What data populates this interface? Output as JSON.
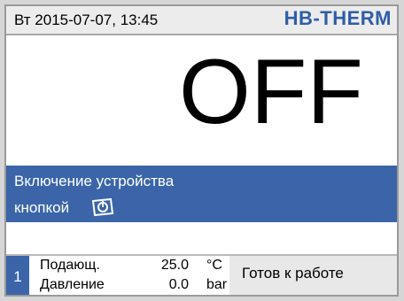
{
  "header": {
    "datetime": "Вт  2015-07-07, 13:45",
    "logo": "HB-THERM"
  },
  "main": {
    "status": "OFF"
  },
  "info": {
    "line1": "Включение устройства",
    "line2": "кнопкой",
    "icon": "power-button-icon"
  },
  "footer": {
    "unit_number": "1",
    "params": [
      {
        "label": "Подающ.",
        "value": "25.0",
        "unit": "°C"
      },
      {
        "label": "Давление",
        "value": "0.0",
        "unit": "bar"
      }
    ],
    "status_text": "Готов к работе"
  },
  "colors": {
    "accent": "#3b65a8",
    "logo": "#2f5da6",
    "header_bg": "#ececec"
  }
}
